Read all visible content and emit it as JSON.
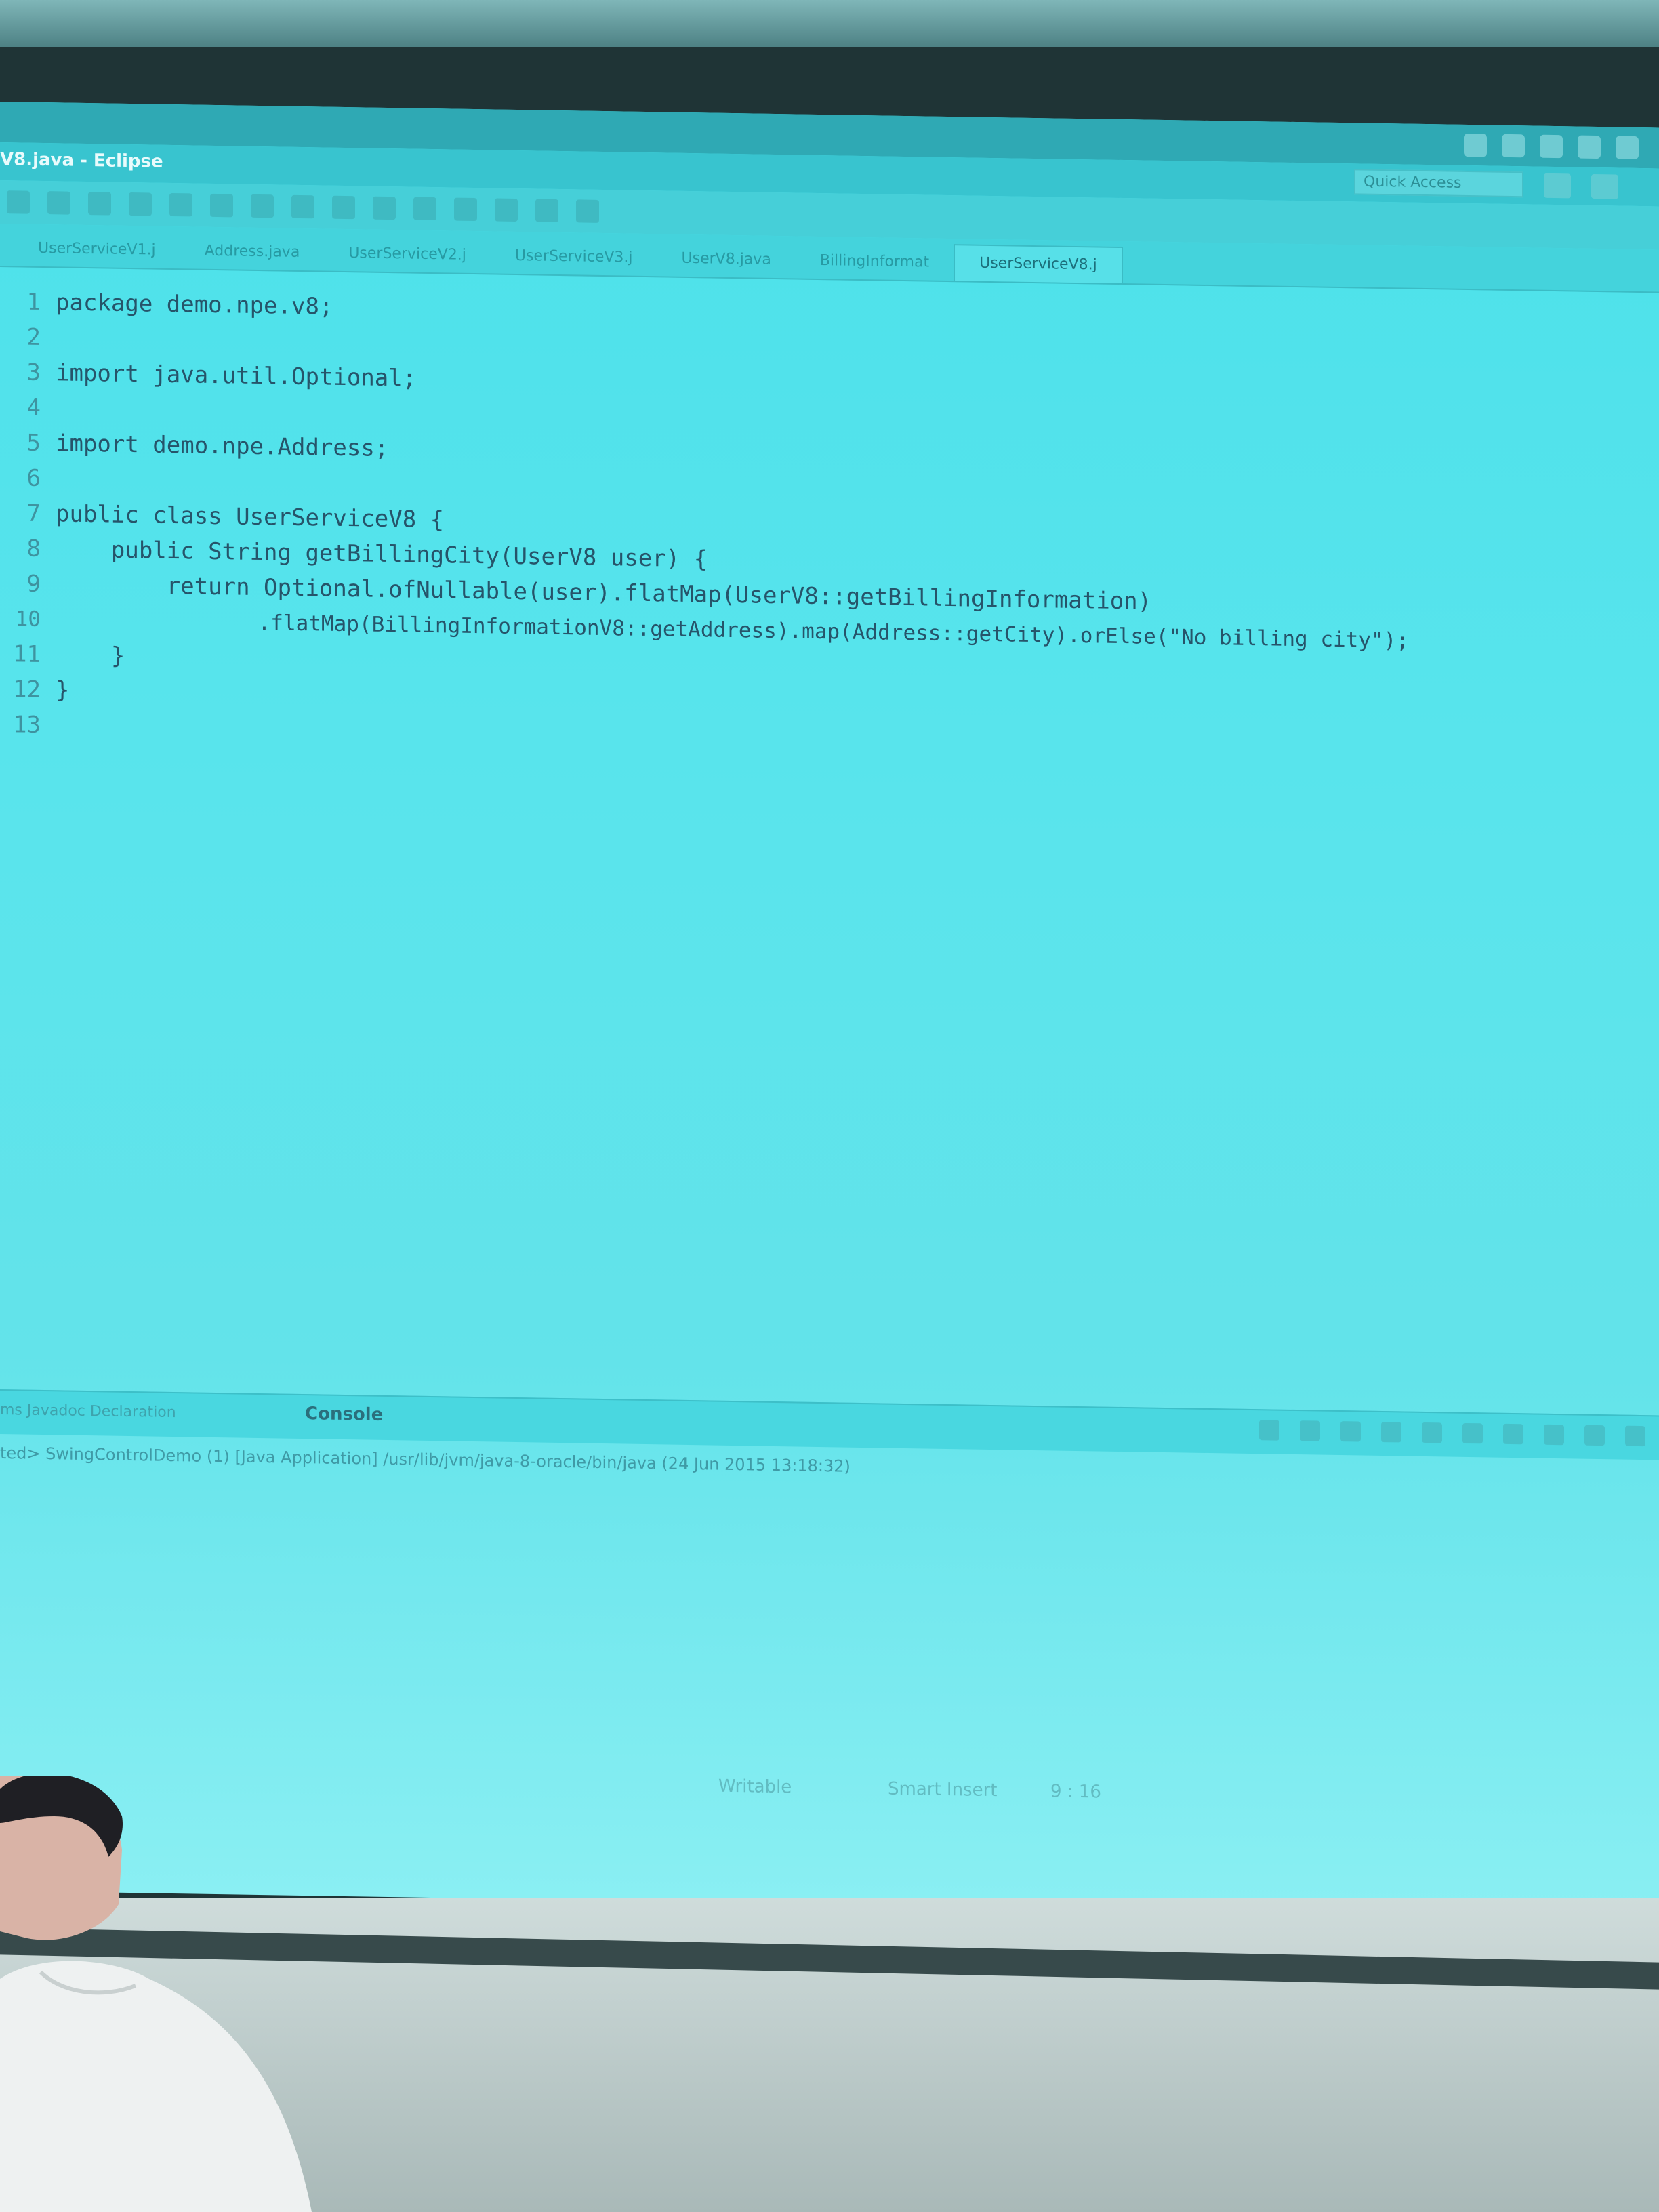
{
  "window": {
    "title": "V8.java - Eclipse",
    "quick_access_placeholder": "Quick Access"
  },
  "tabs": [
    {
      "label": "UserServiceV1.j"
    },
    {
      "label": "Address.java"
    },
    {
      "label": "UserServiceV2.j"
    },
    {
      "label": "UserServiceV3.j"
    },
    {
      "label": "UserV8.java"
    },
    {
      "label": "BillingInformat"
    },
    {
      "label": "UserServiceV8.j",
      "active": true
    }
  ],
  "code": [
    {
      "n": "1",
      "text": "package demo.npe.v8;"
    },
    {
      "n": "2",
      "text": ""
    },
    {
      "n": "3",
      "text": "import java.util.Optional;"
    },
    {
      "n": "4",
      "text": ""
    },
    {
      "n": "5",
      "text": "import demo.npe.Address;"
    },
    {
      "n": "6",
      "text": ""
    },
    {
      "n": "7",
      "text": "public class UserServiceV8 {"
    },
    {
      "n": "8",
      "text": "    public String getBillingCity(UserV8 user) {"
    },
    {
      "n": "9",
      "text": "        return Optional.ofNullable(user).flatMap(UserV8::getBillingInformation)"
    },
    {
      "n": "10",
      "text": "                .flatMap(BillingInformationV8::getAddress).map(Address::getCity).orElse(\"No billing city\");"
    },
    {
      "n": "11",
      "text": "    }"
    },
    {
      "n": "12",
      "text": "}"
    },
    {
      "n": "13",
      "text": ""
    }
  ],
  "console": {
    "tab_label": "Console",
    "views_label": "ms  Javadoc  Declaration",
    "description": "ted> SwingControlDemo (1) [Java Application] /usr/lib/jvm/java-8-oracle/bin/java (24 Jun 2015 13:18:32)"
  },
  "status": {
    "writable": "Writable",
    "insert_mode": "Smart Insert",
    "position": "9 : 16"
  },
  "colors": {
    "screen": "#55e2ea",
    "code_text": "#26546a",
    "line_numbers": "#3e93a0"
  }
}
